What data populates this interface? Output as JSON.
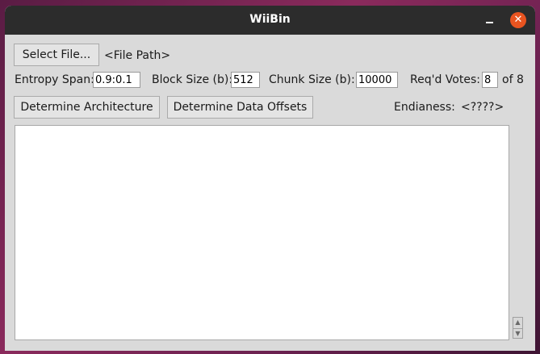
{
  "window": {
    "title": "WiiBin"
  },
  "toolbar": {
    "select_file_label": "Select File...",
    "file_path": "<File Path>"
  },
  "params": {
    "entropy_span_label": "Entropy Span:",
    "entropy_span_value": "0.9:0.1",
    "block_size_label": "Block Size (b):",
    "block_size_value": "512",
    "chunk_size_label": "Chunk Size (b):",
    "chunk_size_value": "10000",
    "votes_label": "Req'd Votes:",
    "votes_value": "8",
    "votes_of": "of 8"
  },
  "actions": {
    "determine_architecture_label": "Determine Architecture",
    "determine_offsets_label": "Determine Data Offsets",
    "endianess_label": "Endianess:",
    "endianess_value": "<????>"
  },
  "output": {
    "text": ""
  },
  "icons": {
    "minimize": "minimize-icon",
    "close": "close-icon",
    "spin_up": "triangle-up-icon",
    "spin_down": "triangle-down-icon"
  },
  "colors": {
    "titlebar": "#2c2c2c",
    "close_button": "#e95420",
    "window_bg": "#dadada"
  }
}
